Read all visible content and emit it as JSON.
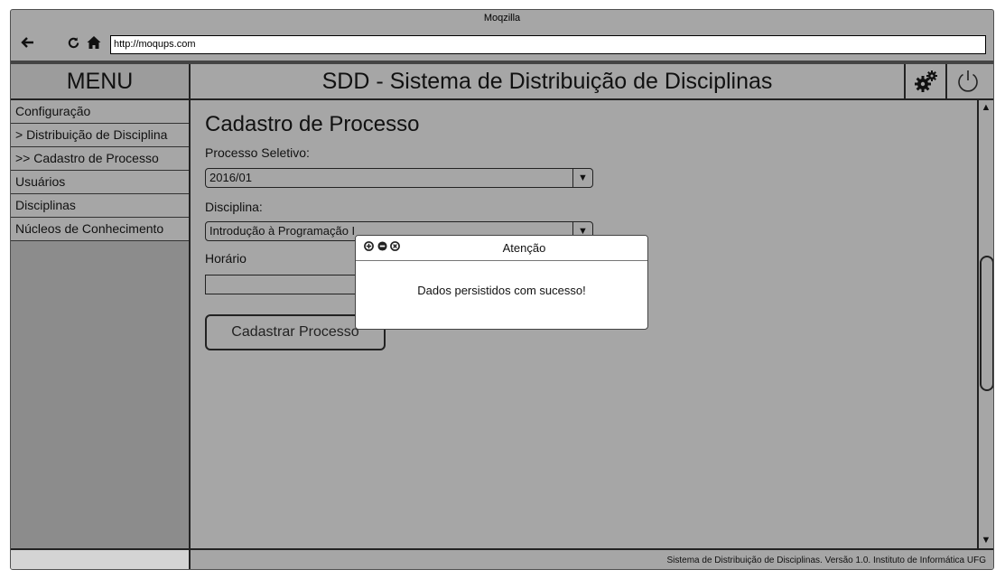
{
  "browser": {
    "title": "Moqzilla",
    "url": "http://moqups.com",
    "back_icon": "arrow-left-icon",
    "reload_icon": "reload-icon",
    "home_icon": "home-icon"
  },
  "menu": {
    "title": "MENU",
    "items": [
      {
        "label": "Configuração"
      },
      {
        "label": "> Distribuição de Disciplina"
      },
      {
        "label": ">> Cadastro de Processo"
      },
      {
        "label": "Usuários"
      },
      {
        "label": "Disciplinas"
      },
      {
        "label": "Núcleos de Conhecimento"
      }
    ]
  },
  "header": {
    "title": "SDD - Sistema de Distribuição de Disciplinas",
    "settings_icon": "gears-icon",
    "power_icon": "power-icon"
  },
  "form": {
    "title": "Cadastro de Processo",
    "processo_label": "Processo Seletivo:",
    "processo_value": "2016/01",
    "disciplina_label": "Disciplina:",
    "disciplina_value": "Introdução à Programação I",
    "horario_label": "Horário",
    "horario_value": "",
    "submit_label": "Cadastrar Processo"
  },
  "dialog": {
    "title": "Atenção",
    "message": "Dados persistidos com sucesso!"
  },
  "footer": {
    "text": "Sistema de Distribuição de Disciplinas. Versão 1.0. Instituto de Informática UFG"
  },
  "colors": {
    "background": "#a6a6a6",
    "sidebar_empty": "#8c8c8c",
    "border": "#222222",
    "dialog": "#ffffff"
  }
}
